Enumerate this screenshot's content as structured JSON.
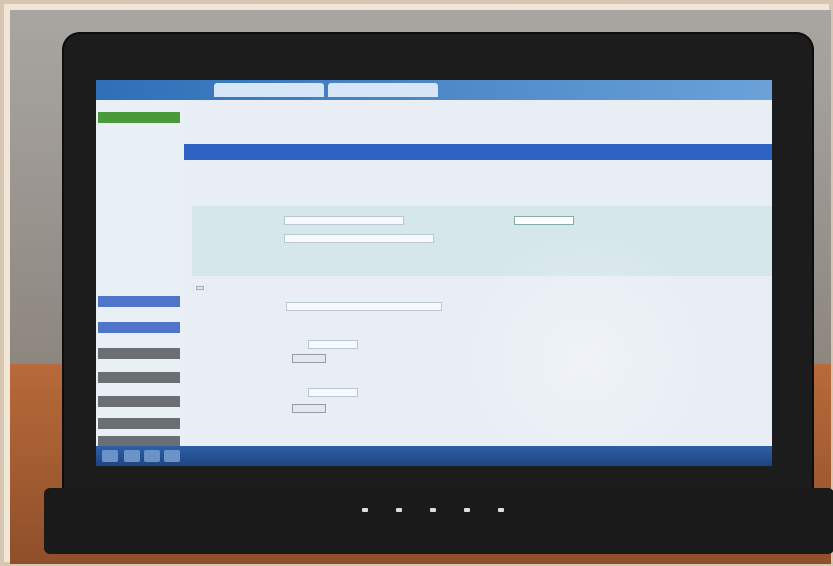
{
  "colors": {
    "browser_bar": "#2f6fb7",
    "section_bar": "#2e63c4",
    "sidebar_green": "#4a9a3a",
    "sidebar_blue": "#4f74c9",
    "sidebar_gray": "#6b6f73",
    "taskbar": "#2e5fa8"
  },
  "browser": {
    "tabs": [
      "",
      ""
    ]
  },
  "sidebar": {
    "head_main": "",
    "items": [
      "",
      "",
      "",
      "",
      "",
      "",
      "",
      "",
      "",
      "",
      ""
    ],
    "bottom_heads": [
      "",
      "",
      "",
      "",
      "",
      "",
      ""
    ]
  },
  "notice": {
    "lines": [
      "",
      "",
      ""
    ]
  },
  "section_bar": "",
  "page_title": "",
  "form": {
    "label_1": "",
    "label_2": "",
    "label_3": "",
    "select_value": "",
    "link_1": "",
    "link_2": "",
    "checkbox_link": ""
  },
  "fieldset": {
    "legend": "",
    "label_a": "",
    "label_b": "",
    "label_c": "",
    "col_1": "",
    "col_2": "",
    "col_3": "",
    "row_text_1": "",
    "row_text_2": "",
    "button_1": "",
    "button_2": ""
  },
  "taskbar": {
    "clock": ""
  },
  "laptop": {
    "brand": ""
  }
}
